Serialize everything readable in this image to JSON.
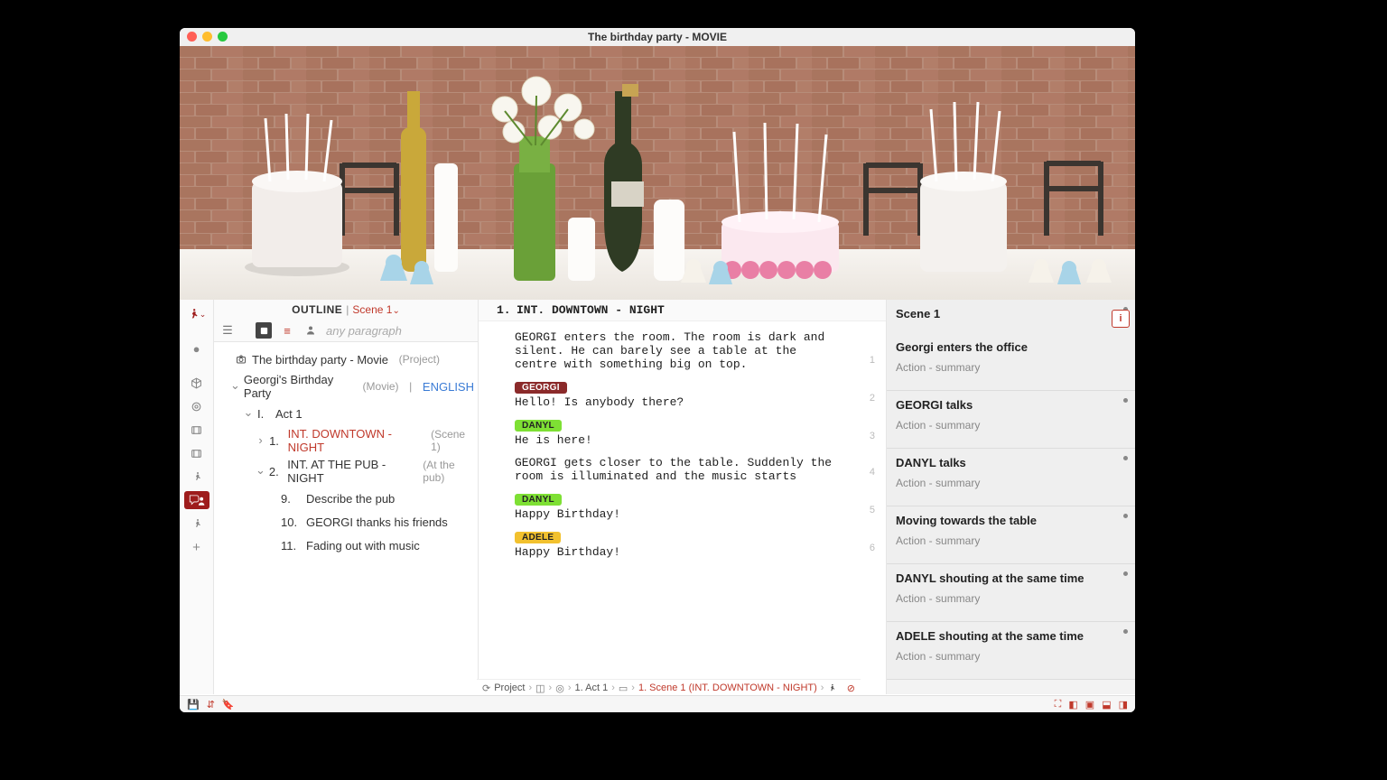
{
  "window": {
    "title": "The birthday party - MOVIE"
  },
  "outline": {
    "header_label": "OUTLINE",
    "header_scene": "Scene 1",
    "search_placeholder": "any paragraph",
    "project_title": "The birthday party - Movie",
    "project_tag": "(Project)",
    "screenplay_title": "Georgi's Birthday Party",
    "screenplay_tag": "(Movie)",
    "language": "ENGLISH",
    "act_num": "I.",
    "act_label": "Act 1",
    "scenes": [
      {
        "num": "1.",
        "slug": "INT.  DOWNTOWN - NIGHT",
        "tag": "(Scene 1)"
      },
      {
        "num": "2.",
        "slug": "INT.  AT THE PUB - NIGHT",
        "tag": "(At the pub)"
      }
    ],
    "beats": [
      {
        "num": "9.",
        "label": "Describe the pub"
      },
      {
        "num": "10.",
        "label": "GEORGI thanks his friends"
      },
      {
        "num": "11.",
        "label": "Fading out with music"
      }
    ]
  },
  "script": {
    "slug_num": "1.",
    "slug": "INT. DOWNTOWN - NIGHT",
    "blocks": [
      {
        "kind": "action",
        "text": "GEORGI enters the room. The room is dark and silent. He can barely see a table at the centre with something big on top.",
        "num": "1"
      },
      {
        "kind": "dialogue",
        "char": "GEORGI",
        "char_class": "c-georgi",
        "text": "Hello! Is anybody there?",
        "num": "2"
      },
      {
        "kind": "dialogue",
        "char": "DANYL",
        "char_class": "c-danyl",
        "text": "He is here!",
        "num": "3"
      },
      {
        "kind": "action",
        "text": "GEORGI gets closer to the table. Suddenly the room is illuminated and the music starts",
        "num": "4"
      },
      {
        "kind": "dialogue",
        "char": "DANYL",
        "char_class": "c-danyl",
        "text": "Happy Birthday!",
        "num": "5"
      },
      {
        "kind": "dialogue",
        "char": "ADELE",
        "char_class": "c-adele",
        "text": "Happy Birthday!",
        "num": "6"
      }
    ]
  },
  "cards": [
    {
      "title": "Scene 1",
      "sub": "Georgi enters the office",
      "meta": "Action - summary",
      "first": true
    },
    {
      "title": "GEORGI talks",
      "meta": "Action - summary"
    },
    {
      "title": "DANYL talks",
      "meta": "Action - summary"
    },
    {
      "title": "Moving towards the table",
      "meta": "Action - summary"
    },
    {
      "title": "DANYL shouting at the same time",
      "meta": "Action - summary"
    },
    {
      "title": "ADELE shouting at the same time",
      "meta": "Action - summary"
    }
  ],
  "breadcrumb": {
    "project": "Project",
    "act": "1. Act 1",
    "scene": "1. Scene 1 (INT.  DOWNTOWN - NIGHT)"
  }
}
